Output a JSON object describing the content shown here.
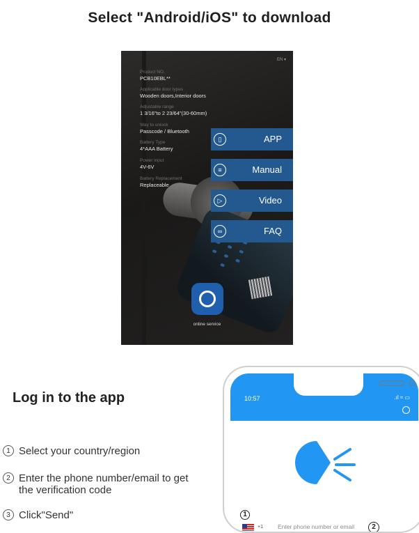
{
  "title": "Select \"Android/iOS\" to download",
  "product_screen": {
    "language": "EN ▾",
    "specs": [
      {
        "label": "Product NO.",
        "value": "PCB10EBL**"
      },
      {
        "label": "Applicable door types",
        "value": "Wooden doors,Interior doors"
      },
      {
        "label": "Adjustable range",
        "value": "1 3/16\"to 2 23/64\"(30-60mm)"
      },
      {
        "label": "Way to unlock",
        "value": "Passcode / Bluetooth"
      },
      {
        "label": "Battery Type",
        "value": "4*AAA Battery"
      },
      {
        "label": "Power input",
        "value": "4V-6V"
      },
      {
        "label": "Battery Replacement",
        "value": "Replaceable"
      }
    ],
    "menu": [
      {
        "label": "APP",
        "icon": "phone-icon"
      },
      {
        "label": "Manual",
        "icon": "book-icon"
      },
      {
        "label": "Video",
        "icon": "play-icon"
      },
      {
        "label": "FAQ",
        "icon": "chat-icon"
      }
    ],
    "service_label": "online service",
    "accent": "#24598f"
  },
  "login": {
    "heading": "Log in to the app",
    "steps": [
      {
        "num": "1",
        "text": "Select your country/region"
      },
      {
        "num": "2",
        "text": "Enter the phone number/email to get the verification code"
      },
      {
        "num": "3",
        "text": "Click\"Send\""
      }
    ]
  },
  "phone": {
    "time": "10:57",
    "status": ".ıl ≈ ▭",
    "country_code": "+1",
    "input_placeholder": "Enter phone number or email",
    "marker1": "1",
    "marker2": "2",
    "brand_color": "#2196f3"
  }
}
